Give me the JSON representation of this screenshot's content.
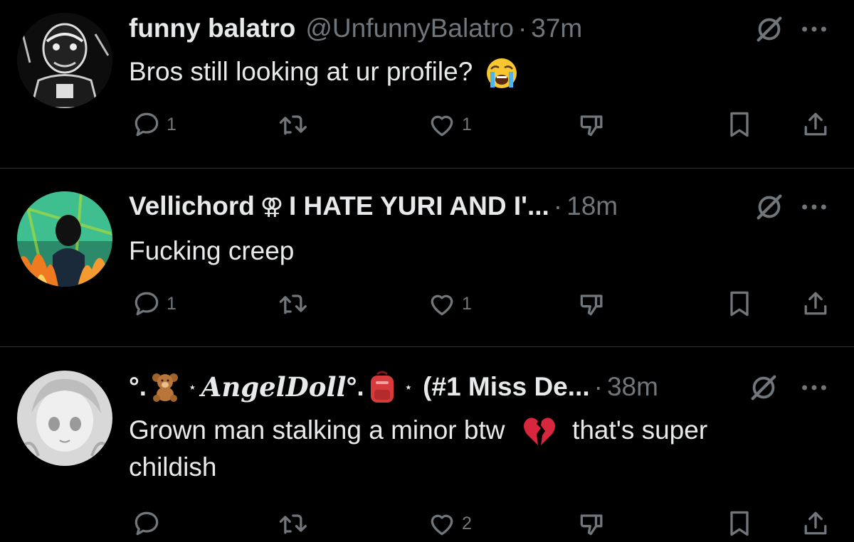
{
  "tweets": [
    {
      "name": "funny balatro",
      "handle": "@UnfunnyBalatro",
      "separator": "·",
      "time": "37m",
      "text": "Bros still looking at ur profile?",
      "emoji": "loudly-crying-face",
      "reply_count": "1",
      "like_count": "1",
      "avatar_icon": "sketch-portrait-avatar"
    },
    {
      "name": "Vellichord",
      "name_symbol": "⚢",
      "name_rest": "I HATE YURI AND I'...",
      "separator": "·",
      "time": "18m",
      "text": "Fucking creep",
      "reply_count": "1",
      "like_count": "1",
      "avatar_icon": "anime-fire-avatar"
    },
    {
      "name_prefix": "°.",
      "name_emoji1": "teddy-bear",
      "name_star": "⋆",
      "name_main": "AngelDoll",
      "name_suffix": "°.",
      "name_emoji2": "backpack",
      "name_star2": "⋆",
      "name_rest": "(#1 Miss De...",
      "separator": "·",
      "time": "38m",
      "text_part1": "Grown man stalking a minor btw",
      "text_emoji": "broken-heart",
      "text_part2": "that's super",
      "text_line2": "childish",
      "like_count": "2",
      "avatar_icon": "anime-girl-avatar"
    }
  ],
  "icons": {
    "grok": "grok-slash-icon",
    "more": "more-dots-icon",
    "reply": "reply-icon",
    "retweet": "retweet-icon",
    "like": "like-icon",
    "dislike": "dislike-icon",
    "bookmark": "bookmark-icon",
    "share": "share-icon"
  },
  "colors": {
    "background": "#000000",
    "text": "#e7e9ea",
    "muted": "#71767b",
    "divider": "#2f3336"
  }
}
